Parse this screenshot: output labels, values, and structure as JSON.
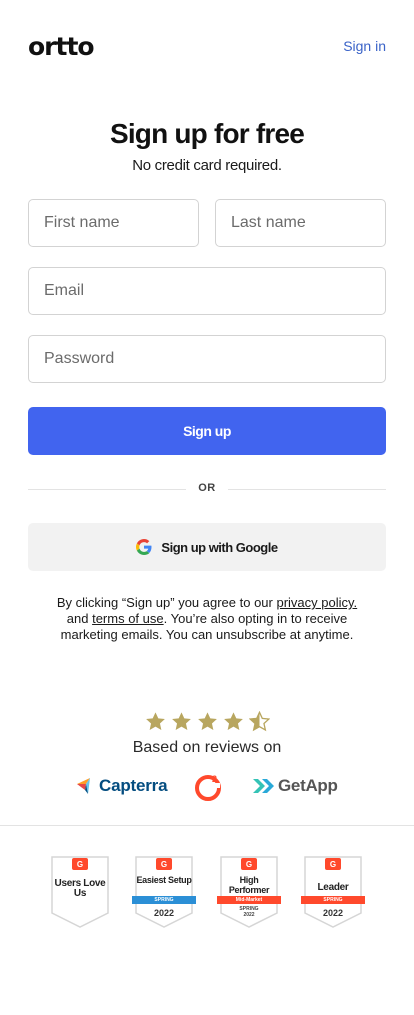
{
  "header": {
    "logo": "ortto",
    "signin_label": "Sign in"
  },
  "main": {
    "title": "Sign up for free",
    "subtitle": "No credit card required.",
    "fields": {
      "first_name_placeholder": "First name",
      "last_name_placeholder": "Last name",
      "email_placeholder": "Email",
      "password_placeholder": "Password"
    },
    "signup_label": "Sign up",
    "or_label": "OR",
    "google_label": "Sign up with Google",
    "legal": {
      "part1": "By clicking “Sign up” you agree to our ",
      "privacy_link": "privacy policy.",
      "part2": " and ",
      "terms_link": "terms of use",
      "part3": ". You’re also opting in to receive marketing emails. You can unsubscribe at anytime."
    }
  },
  "reviews": {
    "rating": 4.5,
    "max_rating": 5,
    "text": "Based on reviews on",
    "sites": {
      "capterra": "Capterra",
      "g2": "G2",
      "getapp": "GetApp"
    }
  },
  "badges": [
    {
      "title": "Users Love Us",
      "ribbon": "",
      "season": "",
      "year": ""
    },
    {
      "title": "Easiest Setup",
      "ribbon": "SPRING",
      "season": "",
      "year": "2022"
    },
    {
      "title": "High Performer",
      "ribbon": "Mid-Market",
      "season": "SPRING",
      "year": "2022"
    },
    {
      "title": "Leader",
      "ribbon": "SPRING",
      "season": "",
      "year": "2022"
    }
  ],
  "colors": {
    "primary": "#4164ef",
    "link": "#3a63c8",
    "star": "#b8a65f",
    "g2_red": "#ff492c",
    "capterra_blue": "#044d80"
  }
}
